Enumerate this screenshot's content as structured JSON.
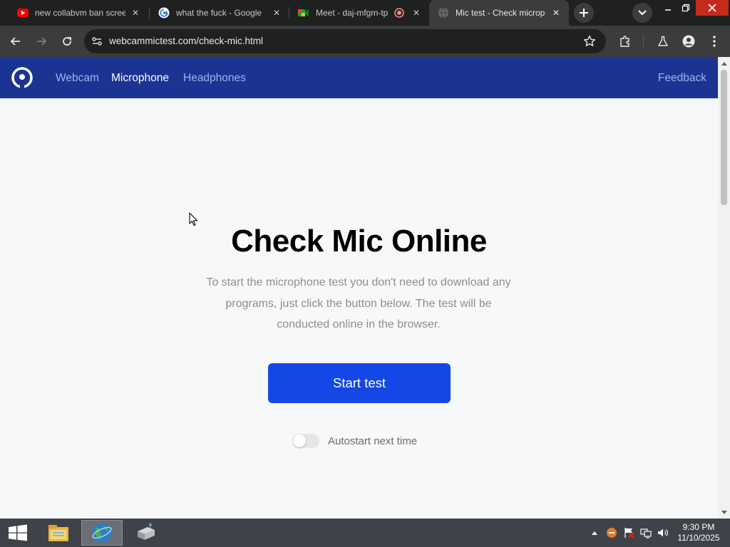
{
  "browser": {
    "tabs": [
      {
        "title": "new collabvm ban scree",
        "icon": "youtube-icon"
      },
      {
        "title": "what the fuck - Google",
        "icon": "google-icon"
      },
      {
        "title": "Meet - daj-mfgm-tp",
        "icon": "meet-icon"
      },
      {
        "title": "Mic test - Check microp",
        "icon": "globe-icon",
        "active": true
      }
    ],
    "close_glyph": "✕",
    "url": "webcammictest.com/check-mic.html"
  },
  "site": {
    "nav": {
      "items": [
        "Webcam",
        "Microphone",
        "Headphones"
      ],
      "active": "Microphone",
      "feedback": "Feedback"
    },
    "hero": {
      "title": "Check Mic Online",
      "description": "To start the microphone test you don't need to download any programs, just click the button below. The test will be conducted online in the browser.",
      "button": "Start test",
      "autostart_label": "Autostart next time",
      "autostart_enabled": false
    }
  },
  "colors": {
    "nav_bg": "#1b3493",
    "button_bg": "#1546e6",
    "page_bg": "#f7f8fa"
  },
  "taskbar": {
    "time": "9:30 PM",
    "date": "11/10/2025",
    "apps": [
      "file-explorer-icon",
      "browser-icon",
      "network-app-icon"
    ]
  }
}
